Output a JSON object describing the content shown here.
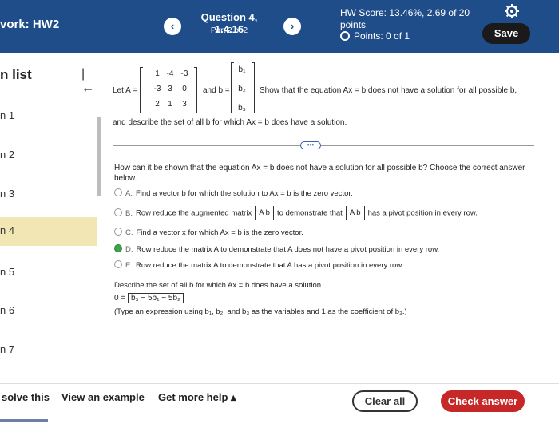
{
  "header": {
    "hw_title": "vork: HW2",
    "prev_icon": "chevron-left-icon",
    "next_icon": "chevron-right-icon",
    "prev_glyph": "‹",
    "next_glyph": "›",
    "question_title": "Question 4, 1.4.16",
    "question_part": "Part 2 of 2",
    "hw_score": "HW Score: 13.46%, 2.69 of 20 points",
    "points": "Points: 0 of 1",
    "save_label": "Save",
    "accent": "#1f4d8a"
  },
  "sidebar": {
    "title": "n list",
    "collapse_glyph": "|←",
    "items": [
      {
        "label": "n 1"
      },
      {
        "label": "n 2"
      },
      {
        "label": "n 3"
      },
      {
        "label": "n 4"
      },
      {
        "label": "n 5"
      },
      {
        "label": "n 6"
      },
      {
        "label": "n 7"
      }
    ],
    "active_index": 3
  },
  "question": {
    "let_a": "Let A =",
    "matrix_a": [
      [
        "1",
        "-4",
        "-3"
      ],
      [
        "-3",
        "3",
        "0"
      ],
      [
        "2",
        "1",
        "3"
      ]
    ],
    "and_b": "and b =",
    "vector_b": [
      "b₁",
      "b₂",
      "b₃"
    ],
    "statement": "Show that the equation Ax = b does not have a solution for all possible b,",
    "statement_cont": "and describe the set of all b for which Ax = b does have a solution.",
    "more_glyph": "•••",
    "prompt": "How can it be shown that the equation Ax = b does not have a solution for all possible b? Choose the correct answer below.",
    "options": [
      {
        "letter": "A.",
        "text": "Find a vector b for which the solution to Ax = b is the zero vector.",
        "selected": false
      },
      {
        "letter": "B.",
        "text_before": "Row reduce the augmented matrix",
        "aug": "A  b",
        "text_mid": "to demonstrate that",
        "aug2": "A  b",
        "text_after": "has a pivot position in every row.",
        "selected": false
      },
      {
        "letter": "C.",
        "text": "Find a vector x for which Ax = b is the zero vector.",
        "selected": false
      },
      {
        "letter": "D.",
        "text": "Row reduce the matrix A to demonstrate that A does not have a pivot position in every row.",
        "selected": true
      },
      {
        "letter": "E.",
        "text": "Row reduce the matrix A to demonstrate that A has a pivot position in every row.",
        "selected": false
      }
    ],
    "describe": "Describe the set of all b for which Ax = b does have a solution.",
    "answer_prefix": "0 =",
    "answer_value": "b₃ − 5b₁ − 5b₂",
    "hint": "(Type an expression using b₁, b₂, and b₃ as the variables and 1 as the coefficient of b₃.)"
  },
  "footer": {
    "solve": "solve this",
    "example": "View an example",
    "help": "Get more help ▴",
    "clear": "Clear all",
    "check": "Check answer"
  }
}
